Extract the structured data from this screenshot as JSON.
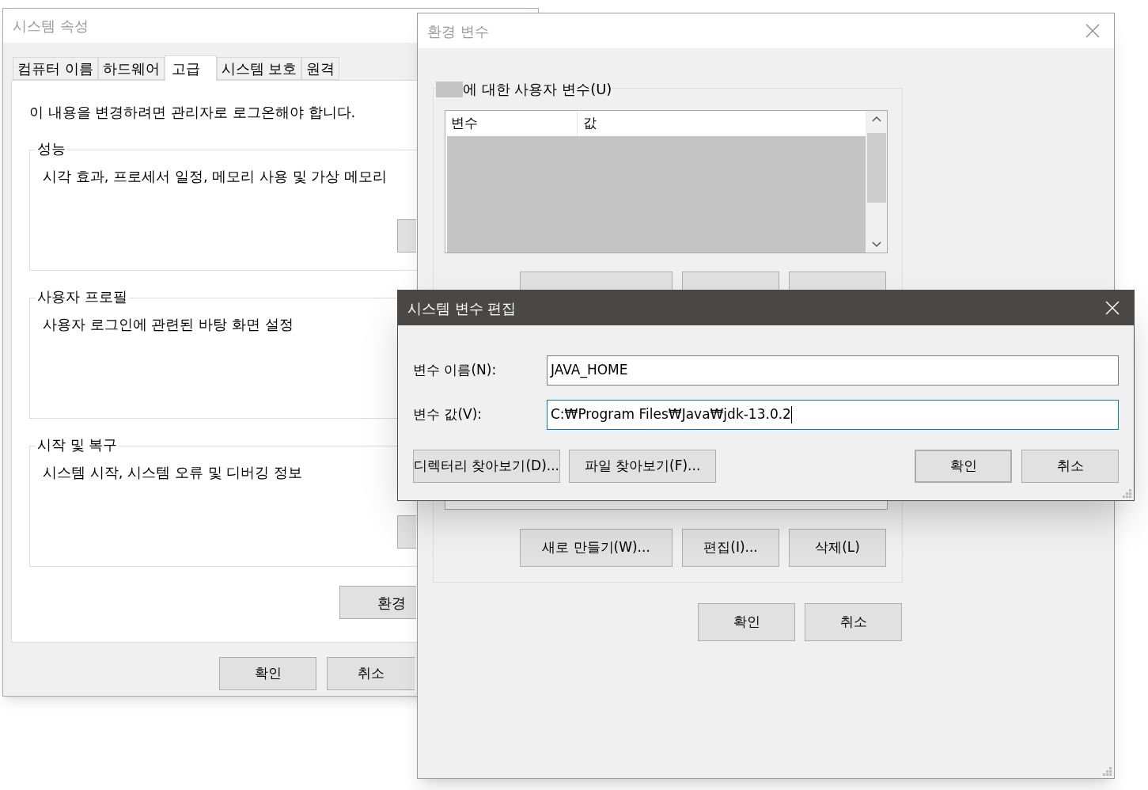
{
  "system_properties": {
    "title": "시스템 속성",
    "tabs": [
      {
        "label": "컴퓨터 이름",
        "selected": false
      },
      {
        "label": "하드웨어",
        "selected": false
      },
      {
        "label": "고급",
        "selected": true
      },
      {
        "label": "시스템 보호",
        "selected": false
      },
      {
        "label": "원격",
        "selected": false
      }
    ],
    "notice": "이 내용을 변경하려면 관리자로 로그온해야 합니다.",
    "groups": [
      {
        "title": "성능",
        "description": "시각 효과, 프로세서 일정, 메모리 사용 및 가상 메모리"
      },
      {
        "title": "사용자 프로필",
        "description": "사용자 로그인에 관련된 바탕 화면 설정"
      },
      {
        "title": "시작 및 복구",
        "description": "시스템 시작, 시스템 오류 및 디버깅 정보"
      }
    ],
    "env_button": "환경",
    "buttons": [
      "확인",
      "취소"
    ]
  },
  "environment_variables": {
    "title": "환경 변수",
    "user_group_label": "에 대한 사용자 변수(U)",
    "columns": [
      "변수",
      "값"
    ],
    "system_buttons": [
      "새로 만들기(W)...",
      "편집(I)...",
      "삭제(L)"
    ],
    "buttons": [
      "확인",
      "취소"
    ]
  },
  "edit_dialog": {
    "title": "시스템 변수 편집",
    "fields": [
      {
        "label": "변수 이름(N):",
        "value": "JAVA_HOME",
        "focused": false
      },
      {
        "label": "변수 값(V):",
        "value": "C:₩Program Files₩Java₩jdk-13.0.2",
        "focused": true
      }
    ],
    "browse_buttons": [
      "디렉터리 찾아보기(D)...",
      "파일 찾아보기(F)..."
    ],
    "buttons": [
      {
        "label": "확인",
        "default": true
      },
      {
        "label": "취소",
        "default": false
      }
    ]
  }
}
